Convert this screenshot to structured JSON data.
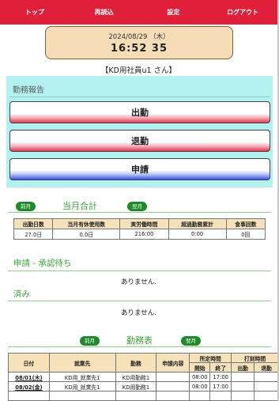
{
  "nav": {
    "items": [
      {
        "id": "top",
        "label": "トップ"
      },
      {
        "id": "reload",
        "label": "再読込"
      },
      {
        "id": "settings",
        "label": "設定"
      },
      {
        "id": "logout",
        "label": "ログアウト"
      }
    ]
  },
  "clock": {
    "date": "2024/08/29 （木）",
    "time": "16:52 35"
  },
  "user": {
    "label": "【KD用社員u1 さん】"
  },
  "report": {
    "title": "勤務報告",
    "buttons": {
      "clock_in": "出勤",
      "clock_out": "退勤",
      "apply": "申請"
    }
  },
  "summary": {
    "prev": "前月",
    "next": "翌月",
    "title": "当月合計",
    "headers": [
      "出勤日数",
      "当月有休使用数",
      "実労働時間",
      "超過勤務累計",
      "食事回数"
    ],
    "values": [
      "27.0日",
      "0.0日",
      "216:00",
      "0:00",
      "0回"
    ]
  },
  "pending": {
    "title": "申請 - 承認待ち",
    "empty": "ありません."
  },
  "done": {
    "title": "済み",
    "empty": "ありません."
  },
  "worktable": {
    "prev": "前月",
    "next": "翌月",
    "title": "勤務表",
    "headers": {
      "date": "日付",
      "site": "就業先",
      "shift": "勤務",
      "app": "申請内容",
      "scheduled": "所定時間",
      "start": "開始",
      "end": "終了",
      "punch": "打刻時間",
      "in": "出勤",
      "out": "退勤"
    },
    "rows": [
      {
        "date": "08/01(木)",
        "site": "KD用_就業先1",
        "shift": "KD用勤務1",
        "app": "",
        "start": "08:00",
        "end": "17:00",
        "in": "",
        "out": ""
      },
      {
        "date": "08/02(金)",
        "site": "KD用_就業先1",
        "shift": "KD用勤務1",
        "app": "",
        "start": "08:00",
        "end": "17:00",
        "in": "",
        "out": ""
      },
      {
        "date": "",
        "site": "",
        "shift": "",
        "app": "",
        "start": "",
        "end": "",
        "in": "",
        "out": ""
      }
    ]
  }
}
